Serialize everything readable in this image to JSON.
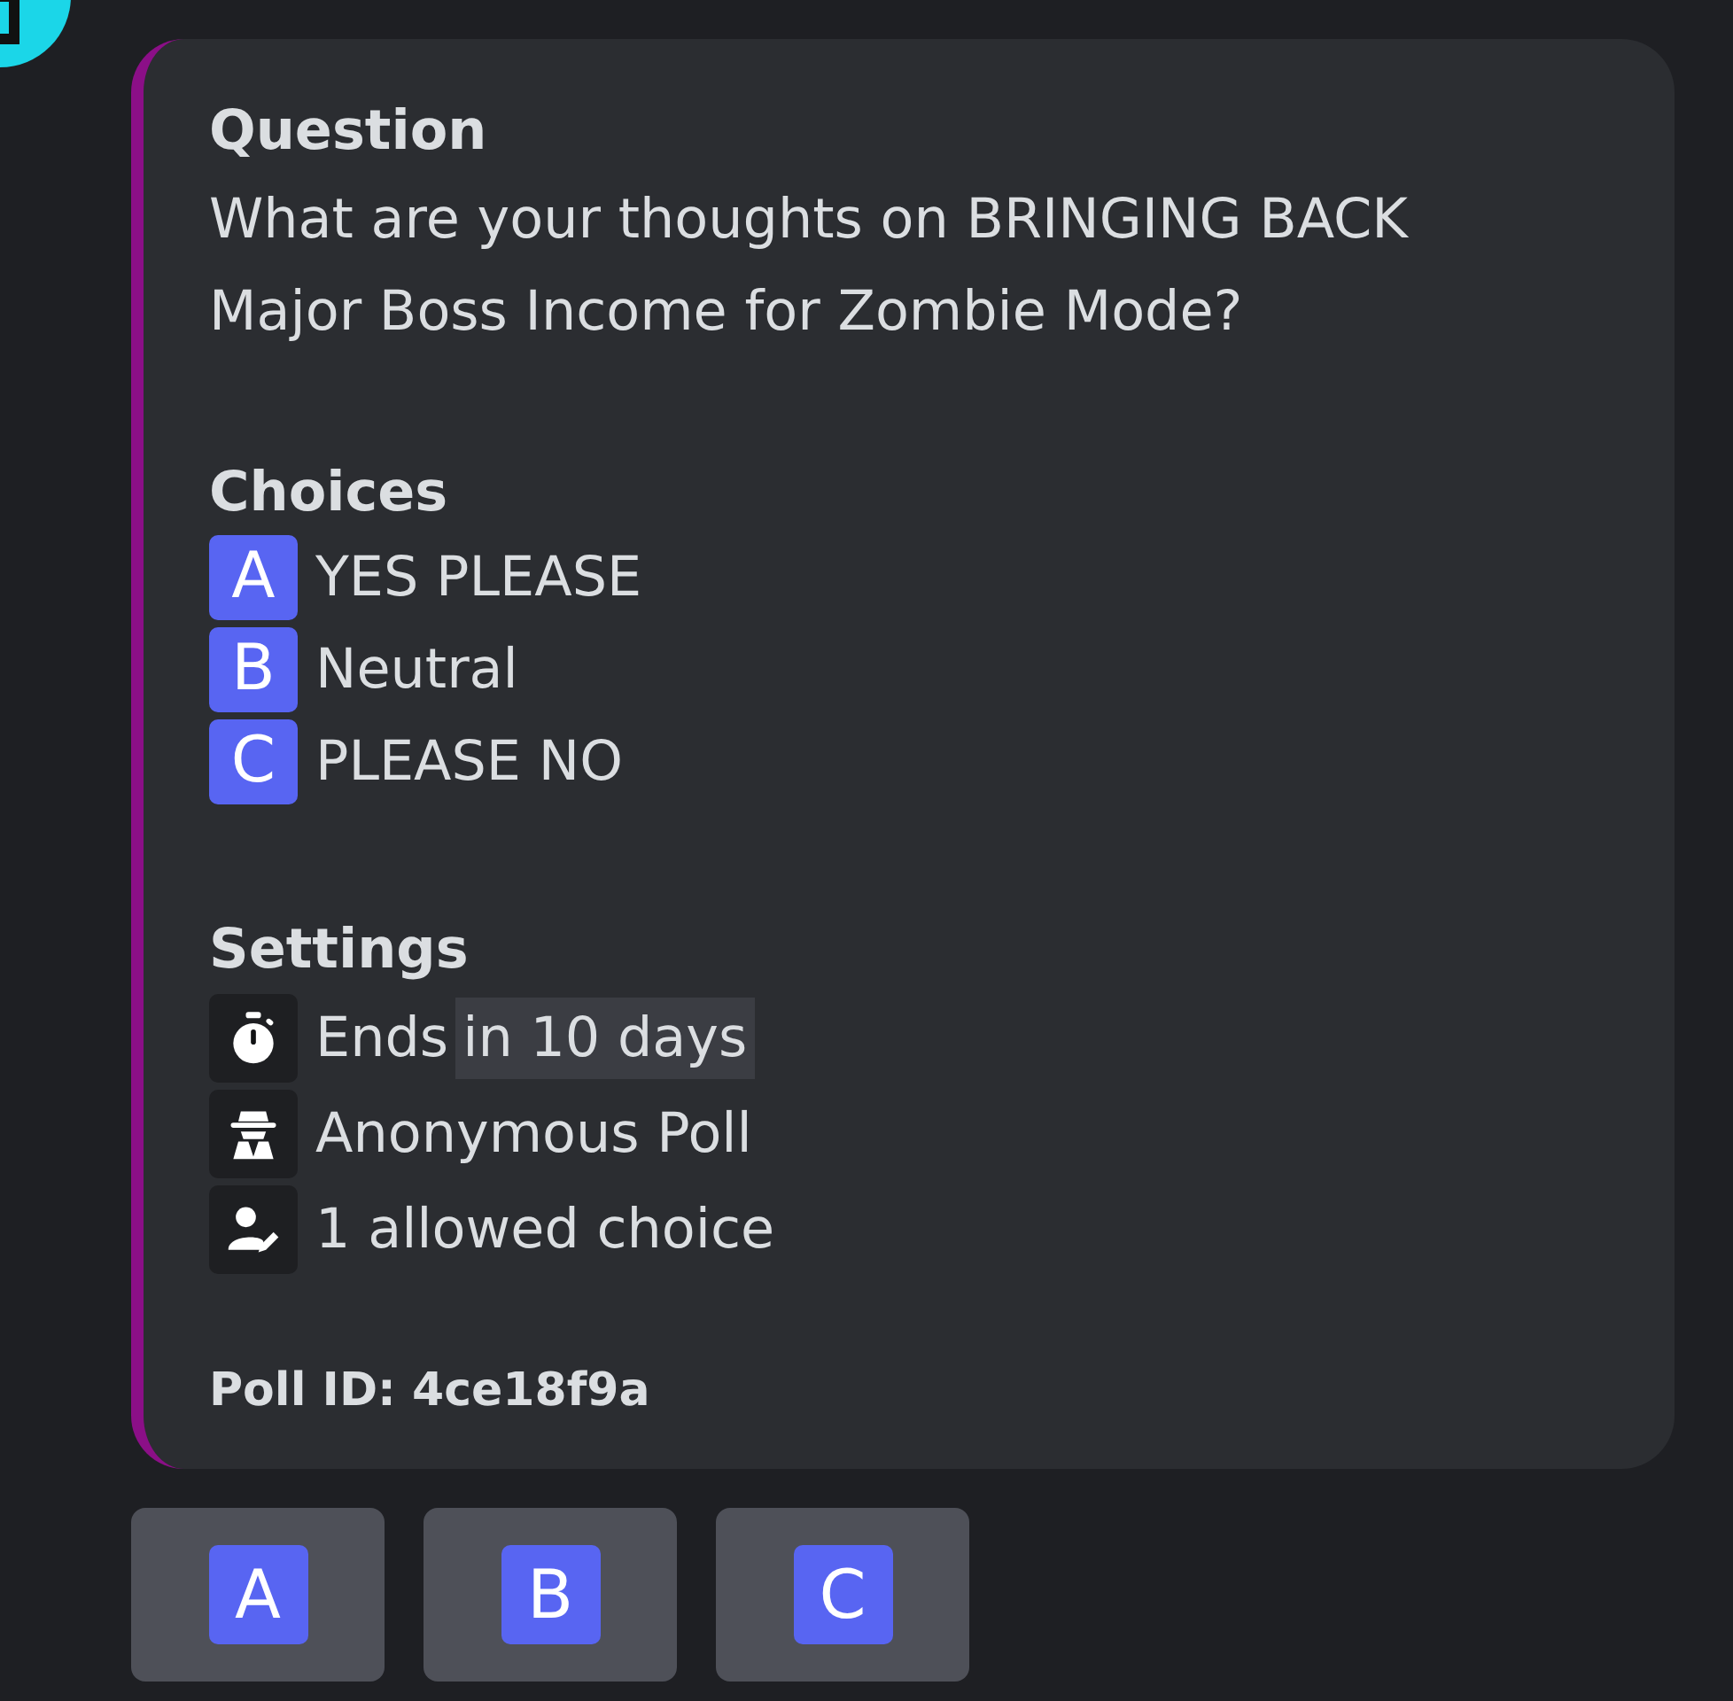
{
  "message": {
    "question": {
      "heading": "Question",
      "text": "What are your thoughts on BRINGING BACK Major Boss Income for Zombie Mode?"
    },
    "choices": {
      "heading": "Choices",
      "items": [
        {
          "letter": "A",
          "label": "YES PLEASE"
        },
        {
          "letter": "B",
          "label": "Neutral"
        },
        {
          "letter": "C",
          "label": "PLEASE NO"
        }
      ]
    },
    "settings": {
      "heading": "Settings",
      "items": [
        {
          "kind": "timer",
          "label": "Ends",
          "timestamp": "in 10 days"
        },
        {
          "kind": "anonymous",
          "label": "Anonymous Poll"
        },
        {
          "kind": "choice",
          "label": "1 allowed choice"
        }
      ]
    },
    "footer": "Poll ID: 4ce18f9a"
  },
  "buttons": [
    "A",
    "B",
    "C"
  ]
}
